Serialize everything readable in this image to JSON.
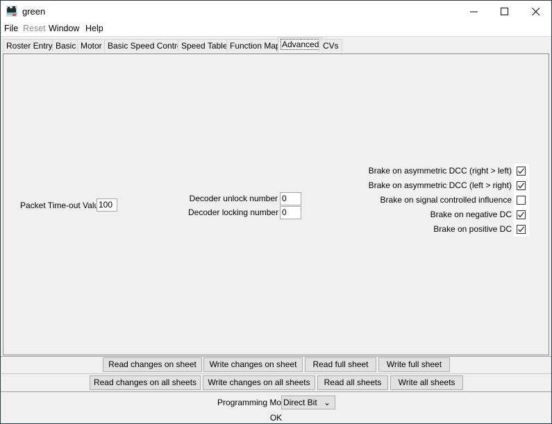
{
  "window": {
    "title": "green",
    "app_icon": "locomotive-icon",
    "controls": {
      "minimize": "–",
      "maximize": "☐",
      "close": "✕"
    }
  },
  "menubar": {
    "items": [
      {
        "label": "File",
        "enabled": true
      },
      {
        "label": "Reset",
        "enabled": false
      },
      {
        "label": "Window",
        "enabled": true
      },
      {
        "label": "Help",
        "enabled": true
      }
    ]
  },
  "tabs": {
    "items": [
      {
        "label": "Roster Entry"
      },
      {
        "label": "Basic"
      },
      {
        "label": "Motor"
      },
      {
        "label": "Basic Speed Control"
      },
      {
        "label": "Speed Table"
      },
      {
        "label": "Function Map"
      },
      {
        "label": "Advanced"
      },
      {
        "label": "CVs"
      }
    ],
    "active": "Advanced"
  },
  "advanced": {
    "packet_timeout": {
      "label": "Packet Time-out Value",
      "value": "100"
    },
    "decoder_unlock": {
      "label": "Decoder unlock number",
      "value": "0"
    },
    "decoder_locking": {
      "label": "Decoder locking number",
      "value": "0"
    },
    "brake_options": [
      {
        "label": "Brake on asymmetric DCC (right > left)",
        "checked": true
      },
      {
        "label": "Brake on asymmetric DCC (left > right)",
        "checked": true
      },
      {
        "label": "Brake on signal controlled influence",
        "checked": false
      },
      {
        "label": "Brake on negative DC",
        "checked": true
      },
      {
        "label": "Brake on positive DC",
        "checked": true
      }
    ]
  },
  "sheet_buttons": {
    "read_changes_on_sheet": "Read changes on sheet",
    "write_changes_on_sheet": "Write changes on sheet",
    "read_full_sheet": "Read full sheet",
    "write_full_sheet": "Write full sheet"
  },
  "all_sheets_buttons": {
    "read_changes_on_all_sheets": "Read changes on all sheets",
    "write_changes_on_all_sheets": "Write changes on all sheets",
    "read_all_sheets": "Read all sheets",
    "write_all_sheets": "Write all sheets"
  },
  "programming_mode": {
    "label": "Programming Mode",
    "selected": "Direct Bit",
    "chevron": "⌄"
  },
  "ok_label": "OK"
}
